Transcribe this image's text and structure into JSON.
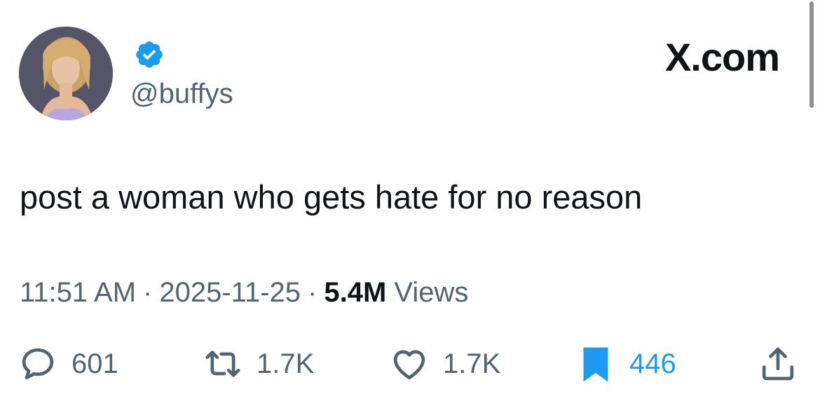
{
  "author": {
    "handle": "@buffys",
    "verified": true,
    "avatar_description": "profile photo"
  },
  "brand": "X.com",
  "tweet": {
    "text": "post a woman who gets hate for no reason",
    "time": "11:51 AM",
    "date": "2025-11-25",
    "separator": "·",
    "views_count": "5.4M",
    "views_label": "Views"
  },
  "actions": {
    "replies": "601",
    "reposts": "1.7K",
    "likes": "1.7K",
    "bookmarks": "446"
  },
  "colors": {
    "accent": "#1d9bf0",
    "text": "#0f1419",
    "secondary": "#536471"
  },
  "icons": [
    "verified-badge-icon",
    "reply-icon",
    "repost-icon",
    "like-icon",
    "bookmark-icon",
    "share-icon"
  ]
}
